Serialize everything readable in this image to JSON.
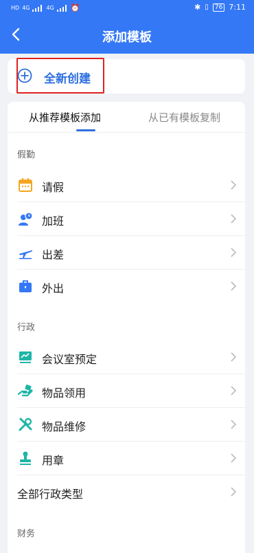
{
  "status": {
    "left_sims": [
      "HD",
      "HD"
    ],
    "networks": [
      "4G",
      "4G"
    ],
    "battery": "76",
    "time": "7:11"
  },
  "header": {
    "title": "添加模板"
  },
  "create": {
    "label": "全新创建"
  },
  "tabs": {
    "active": "从推荐模板添加",
    "inactive": "从已有模板复制"
  },
  "sections": {
    "leave": {
      "title": "假勤"
    },
    "admin": {
      "title": "行政"
    },
    "finance": {
      "title": "财务"
    }
  },
  "leave_items": [
    "请假",
    "加班",
    "出差",
    "外出"
  ],
  "admin_items": [
    "会议室预定",
    "物品领用",
    "物品维修",
    "用章",
    "全部行政类型"
  ],
  "colors": {
    "primary": "#3478f6",
    "accent_blue": "#2f6fe0",
    "highlight": "#e02020",
    "orange": "#f5a623",
    "teal": "#1fb5a5"
  }
}
